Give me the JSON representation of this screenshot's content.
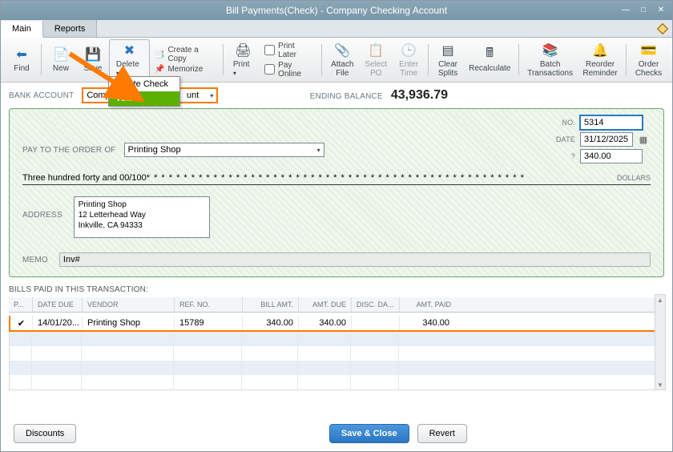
{
  "window": {
    "title": "Bill Payments(Check) - Company Checking Account"
  },
  "tabs": [
    {
      "label": "Main",
      "active": true
    },
    {
      "label": "Reports",
      "active": false
    }
  ],
  "toolbar": {
    "find": "Find",
    "new": "New",
    "save": "Save",
    "delete": "Delete",
    "create_copy": "Create a Copy",
    "memorize": "Memorize",
    "print": "Print",
    "print_later": "Print Later",
    "pay_online": "Pay Online",
    "attach_file": "Attach\nFile",
    "select_po": "Select\nPO",
    "enter_time": "Enter\nTime",
    "clear_splits": "Clear\nSplits",
    "recalculate": "Recalculate",
    "batch_trans": "Batch\nTransactions",
    "reorder_reminder": "Reorder\nReminder",
    "order_checks": "Order\nChecks"
  },
  "delete_menu": {
    "delete_check": "Delete Check",
    "void": "Void"
  },
  "account_row": {
    "label": "BANK ACCOUNT",
    "value_left": "Compa",
    "value_right": "unt",
    "balance_label": "ENDING BALANCE",
    "balance_value": "43,936.79"
  },
  "check": {
    "no_label": "NO.",
    "no_value": "5314",
    "date_label": "DATE",
    "date_value": "31/12/2025",
    "amount_label": "?",
    "amount_value": "340.00",
    "payto_label": "PAY TO THE ORDER OF",
    "payto_value": "Printing Shop",
    "amount_words": "Three hundred forty and 00/100",
    "stars": "* * * * * * * * * * * * * * * * * * * * * * * * * * * * * * * * * * * * * * * * * * * * * * * * * * *",
    "dollars_label": "DOLLARS",
    "address_label": "ADDRESS",
    "address_value": "Printing Shop\n12 Letterhead Way\nInkville, CA 94333",
    "memo_label": "MEMO",
    "memo_value": "Inv#"
  },
  "grid": {
    "title": "BILLS PAID IN THIS TRANSACTION:",
    "headers": [
      "P...",
      "DATE DUE",
      "VENDOR",
      "REF. NO.",
      "BILL AMT.",
      "AMT. DUE",
      "DISC. DA...",
      "AMT. PAID"
    ],
    "rows": [
      {
        "checked": true,
        "date_due": "14/01/20...",
        "vendor": "Printing Shop",
        "ref_no": "15789",
        "bill_amt": "340.00",
        "amt_due": "340.00",
        "disc": "",
        "amt_paid": "340.00"
      }
    ]
  },
  "buttons": {
    "discounts": "Discounts",
    "save_close": "Save & Close",
    "revert": "Revert"
  }
}
